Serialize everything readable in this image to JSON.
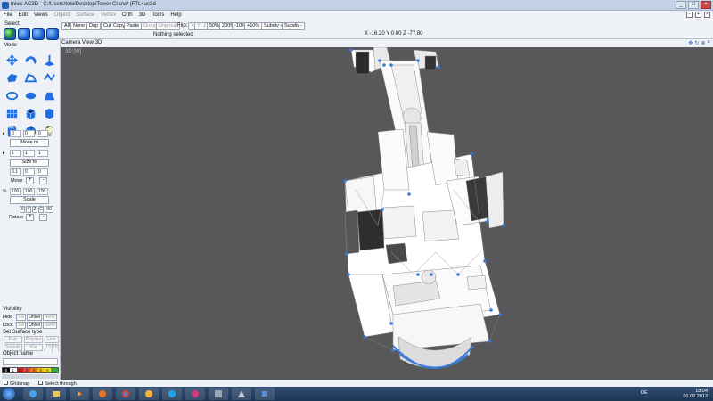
{
  "window": {
    "title": "Inivis AC3D - C:/Users/tobi/Desktop/Tower Crane/ (FTL4ac3d",
    "controls": [
      "_",
      "□",
      "×"
    ]
  },
  "menubar": {
    "items": [
      {
        "label": "File",
        "enabled": true
      },
      {
        "label": "Edit",
        "enabled": true
      },
      {
        "label": "Views",
        "enabled": true
      },
      {
        "label": "Object",
        "enabled": false
      },
      {
        "label": "Surface",
        "enabled": false
      },
      {
        "label": "Vertex",
        "enabled": false
      },
      {
        "label": "Orth",
        "enabled": true
      },
      {
        "label": "3D",
        "enabled": true
      },
      {
        "label": "Tools",
        "enabled": true
      },
      {
        "label": "Help",
        "enabled": true
      }
    ]
  },
  "toolbar": {
    "select_label": "Select",
    "buttons": {
      "all": "All",
      "none": "None",
      "dup": "Dup",
      "cut": "Cut",
      "copy": "Copy",
      "paste": "Paste",
      "group": "Group",
      "ungroup": "Ungroup",
      "flip": "Flip:",
      "flip_x": "X",
      "flip_y": "Y",
      "flip_z": "Z",
      "zoom50": "50%",
      "zoom200": "200%",
      "minus10": "-10%",
      "plus10": "+10%",
      "subdiv_plus": "Subdiv +",
      "subdiv_minus": "Subdiv -"
    },
    "status": "Nothing selected",
    "coords": "X -16.30 Y 0.00 Z -77.80"
  },
  "leftpanel": {
    "mode_label": "Mode",
    "xyz_labels": [
      "x",
      "y",
      "z"
    ],
    "move": {
      "values": [
        "0",
        "0",
        "0"
      ],
      "button": "Move to"
    },
    "size": {
      "values": [
        "1",
        "1",
        "1"
      ],
      "button": "Size to"
    },
    "step": {
      "values": [
        "0.1",
        "0",
        "0"
      ],
      "label": "Move",
      "plus": "+",
      "minus": "-"
    },
    "scale": {
      "prefix": "%",
      "values": [
        "100",
        "100",
        "100"
      ],
      "button": "Scale"
    },
    "rotate": {
      "axes": [
        "X",
        "Y",
        "Z",
        "C"
      ],
      "value": "90",
      "label": "Rotate",
      "plus": "+",
      "minus": "-"
    },
    "visibility": {
      "title": "Visibility",
      "hide_label": "Hide",
      "lock_label": "Lock",
      "sel": "Sel",
      "unsel": "Unsel",
      "none": "None"
    },
    "surface": {
      "title": "Set Surface type",
      "items": [
        "Poly",
        "Polyline",
        "Line",
        "Smooth",
        "Flat",
        "1S",
        "2S"
      ]
    },
    "object_name_label": "Object name",
    "palette": [
      {
        "label": "0",
        "color": "#000000"
      },
      {
        "label": "1",
        "color": "#ffffff"
      },
      {
        "label": "2",
        "color": "#c91f1f"
      },
      {
        "label": "3",
        "color": "#e24545"
      },
      {
        "label": "4",
        "color": "#f07a18"
      },
      {
        "label": "5",
        "color": "#f2c014"
      },
      {
        "label": "6",
        "color": "#e6e628"
      },
      {
        "label": "",
        "color": "#3aa83a"
      }
    ]
  },
  "viewport": {
    "header_tabs": [
      "Camera",
      "View",
      "3D"
    ],
    "title": "3D [W]",
    "icons": [
      "move-view-icon",
      "rotate-view-icon",
      "zoom-fit-icon",
      "close-view-icon"
    ]
  },
  "bottom": {
    "gridsnap": "Gridsnap",
    "select_through": "Select through"
  },
  "taskbar": {
    "apps": [
      "ie-icon",
      "explorer-icon",
      "media-player-icon",
      "firefox-icon",
      "chrome-icon",
      "pinwheel-icon",
      "skype-icon",
      "paint-icon",
      "ac3d-icon",
      "network-icon",
      "crane-icon",
      "notes-icon"
    ],
    "language": "DE",
    "time": "18:04",
    "date": "01.02.2013"
  }
}
